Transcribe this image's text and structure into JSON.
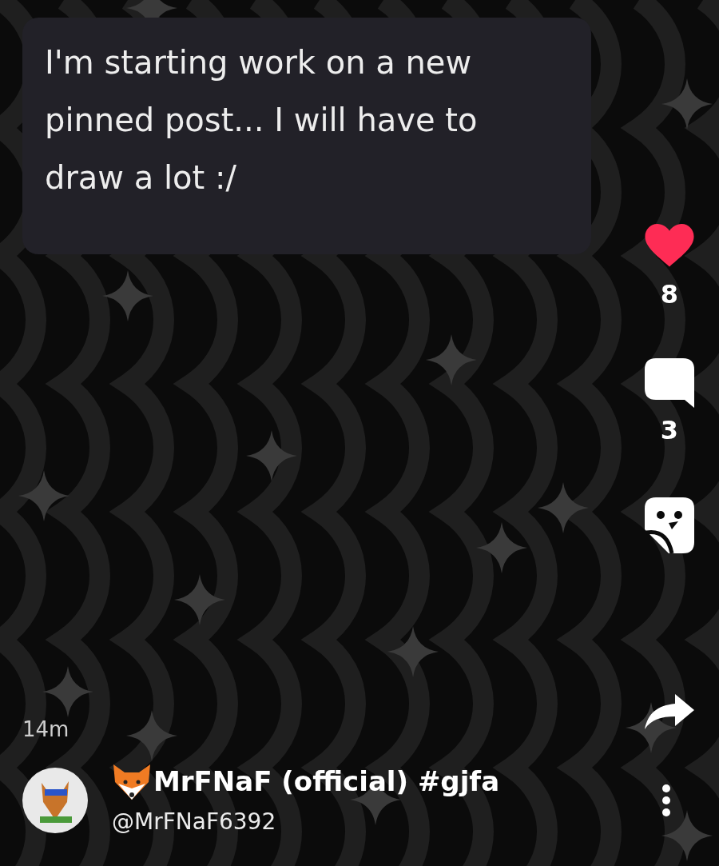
{
  "post": {
    "text": "I'm starting work on a new pinned post... I will have to draw a lot :/",
    "time": "14m"
  },
  "actions": {
    "like": {
      "liked": true,
      "count": "8"
    },
    "comments": {
      "count": "3"
    }
  },
  "author": {
    "display_name": "MrFNaF (official) #gjfa",
    "handle": "@MrFNaF6392"
  }
}
